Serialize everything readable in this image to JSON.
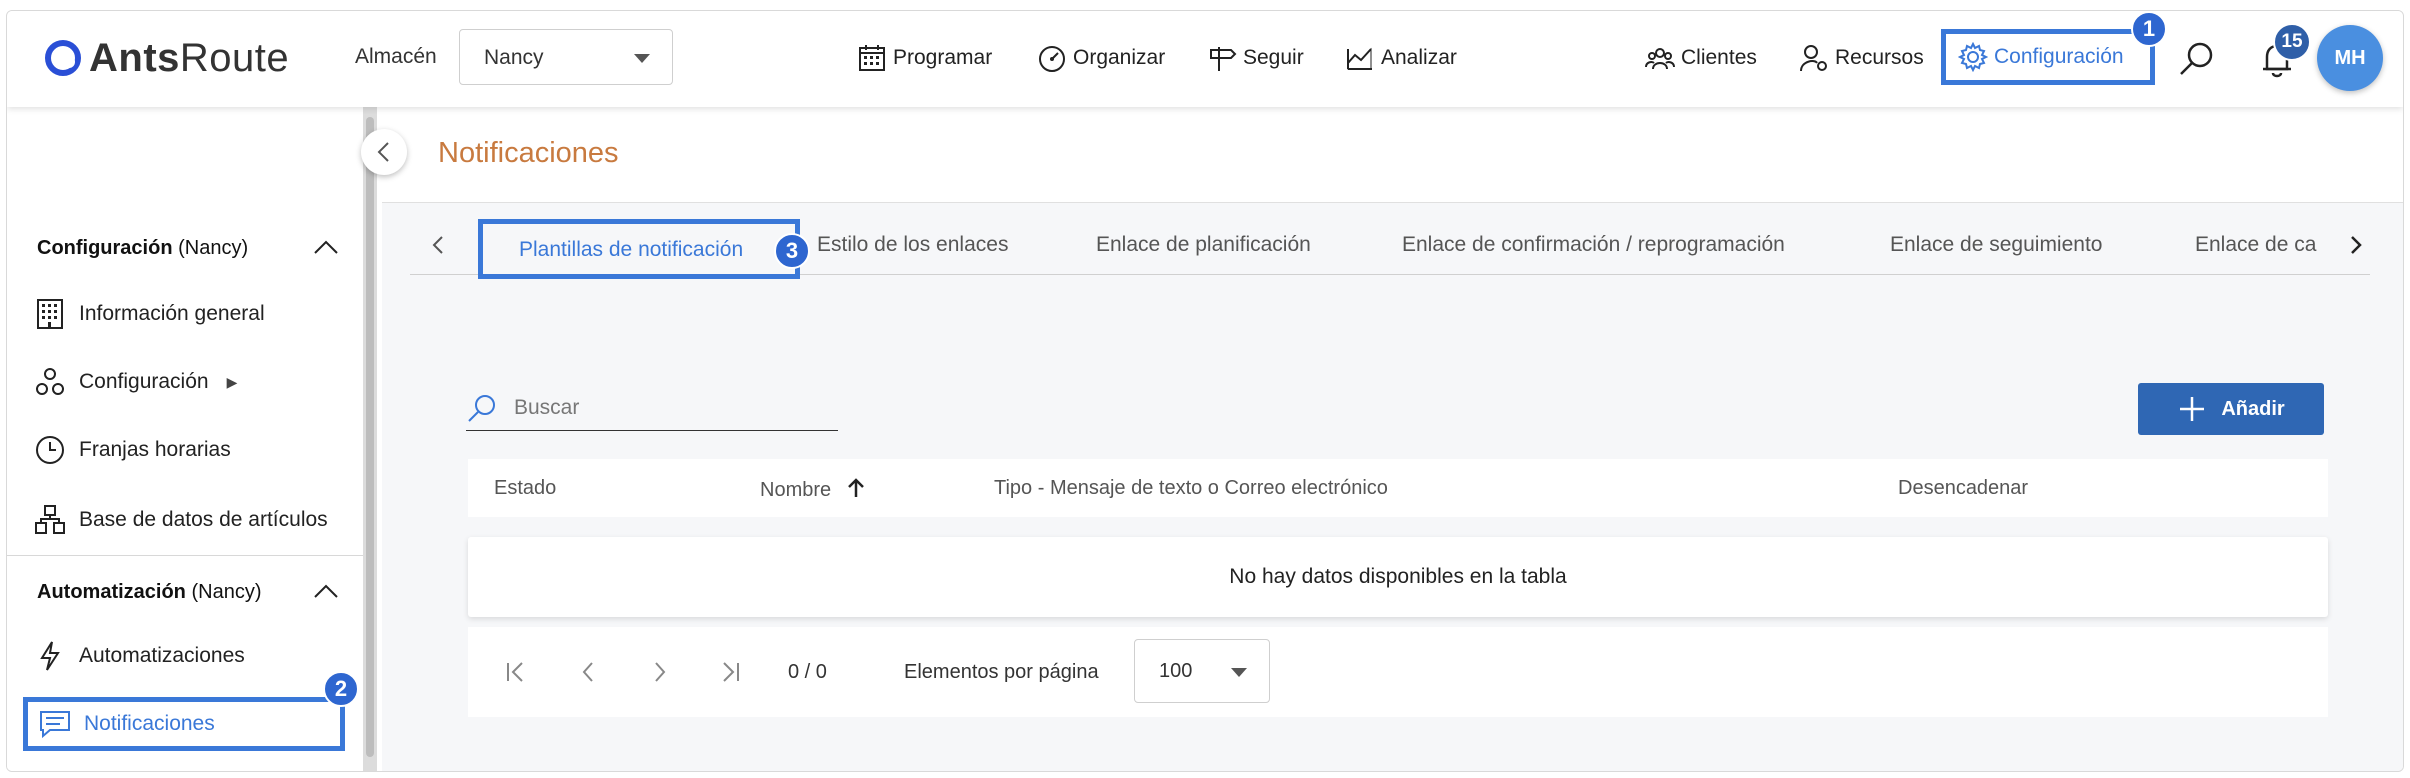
{
  "brand": {
    "name_bold": "Ants",
    "name_light": "Route",
    "accent_color": "#3a78d8"
  },
  "header": {
    "almacen_label": "Almacén",
    "almacen_value": "Nancy",
    "nav": [
      {
        "label": "Programar",
        "icon": "calendar-icon"
      },
      {
        "label": "Organizar",
        "icon": "gauge-icon"
      },
      {
        "label": "Seguir",
        "icon": "signpost-icon"
      },
      {
        "label": "Analizar",
        "icon": "chart-icon"
      },
      {
        "label": "Clientes",
        "icon": "users-icon"
      },
      {
        "label": "Recursos",
        "icon": "resource-icon"
      },
      {
        "label": "Configuración",
        "icon": "gear-icon"
      }
    ],
    "notification_count": "15",
    "avatar_initials": "MH"
  },
  "markers": {
    "config": "1",
    "sidebar": "2",
    "tab": "3"
  },
  "sidebar": {
    "section1": {
      "title": "Configuración",
      "scope": "(Nancy)"
    },
    "section1_items": [
      {
        "label": "Información general"
      },
      {
        "label": "Configuración",
        "submenu_marker": "▶"
      },
      {
        "label": "Franjas horarias"
      },
      {
        "label": "Base de datos de artículos"
      }
    ],
    "section2": {
      "title": "Automatización",
      "scope": "(Nancy)"
    },
    "section2_items": [
      {
        "label": "Automatizaciones"
      },
      {
        "label": "Notificaciones"
      }
    ]
  },
  "main": {
    "title": "Notificaciones",
    "tabs": [
      {
        "label": "Plantillas de notificación"
      },
      {
        "label": "Estilo de los enlaces"
      },
      {
        "label": "Enlace de planificación"
      },
      {
        "label": "Enlace de confirmación / reprogramación"
      },
      {
        "label": "Enlace de seguimiento"
      },
      {
        "label": "Enlace de ca"
      }
    ],
    "search_placeholder": "Buscar",
    "add_label": "Añadir",
    "columns": [
      "Estado",
      "Nombre",
      "Tipo - Mensaje de texto o Correo electrónico",
      "Desencadenar"
    ],
    "empty_text": "No hay datos disponibles en la tabla",
    "pager": {
      "range": "0 / 0",
      "per_page_label": "Elementos por página",
      "per_page_value": "100"
    }
  }
}
